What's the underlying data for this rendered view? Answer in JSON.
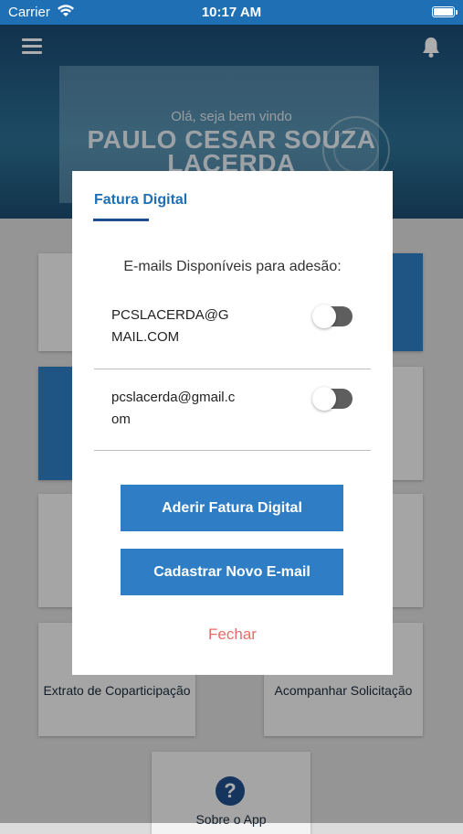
{
  "status_bar": {
    "carrier": "Carrier",
    "time": "10:17 AM",
    "wifi_icon": "wifi-icon",
    "battery_icon": "battery-icon"
  },
  "header": {
    "menu_icon": "hamburger-menu-icon",
    "notification_icon": "bell-icon",
    "greeting": "Olá, seja bem vindo",
    "user_name": "PAULO CESAR SOUZA LACERDA"
  },
  "tiles": {
    "extrato_label": "Extrato de Coparticipação",
    "acompanhar_label": "Acompanhar Solicitação",
    "sobre_label": "Sobre o App",
    "help_icon": "question-circle-icon"
  },
  "modal": {
    "title": "Fatura Digital",
    "heading": "E-mails Disponíveis para adesão:",
    "emails": [
      {
        "address": "PCSLACERDA@GMAIL.COM",
        "enabled": false
      },
      {
        "address": "pcslacerda@gmail.com",
        "enabled": false
      }
    ],
    "primary_button": "Aderir Fatura Digital",
    "secondary_button": "Cadastrar Novo E-mail",
    "close_label": "Fechar"
  },
  "colors": {
    "primary": "#2f7ec5",
    "header_bar": "#1f6fb5",
    "close_link": "#e86b6b"
  }
}
